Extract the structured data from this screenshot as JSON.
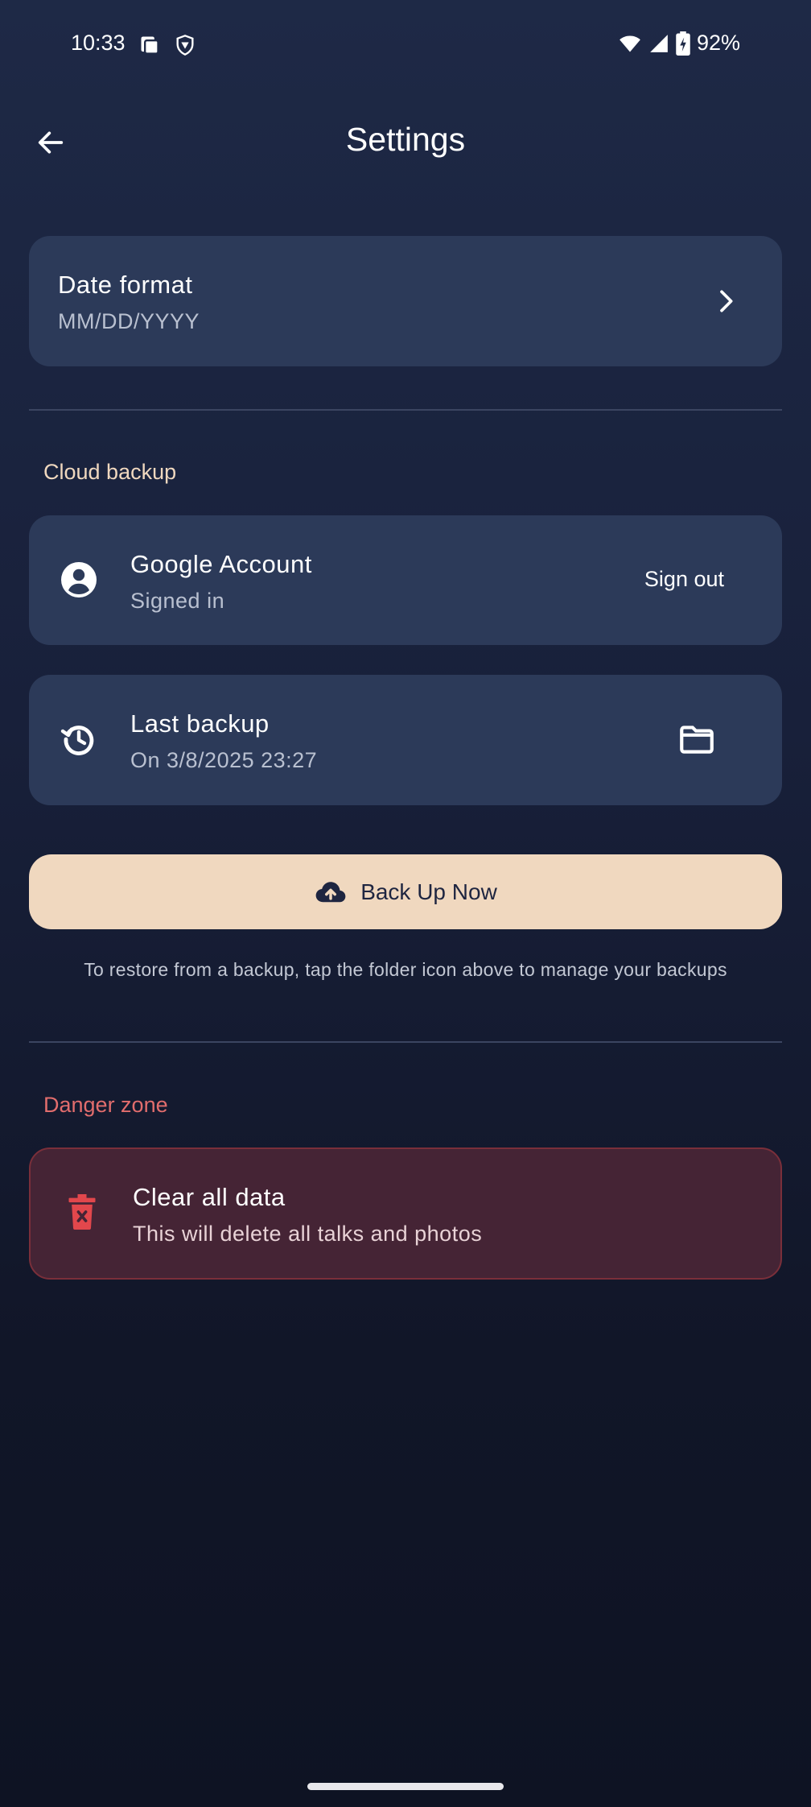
{
  "status_bar": {
    "time": "10:33",
    "battery": "92%"
  },
  "header": {
    "title": "Settings"
  },
  "date_format": {
    "title": "Date format",
    "value": "MM/DD/YYYY"
  },
  "cloud_backup": {
    "section_label": "Cloud backup",
    "account": {
      "title": "Google Account",
      "status": "Signed in",
      "action": "Sign out"
    },
    "last_backup": {
      "title": "Last backup",
      "value": "On 3/8/2025 23:27"
    },
    "backup_button": "Back Up Now",
    "restore_hint": "To restore from a backup, tap the folder icon above to manage your backups"
  },
  "danger_zone": {
    "section_label": "Danger zone",
    "clear": {
      "title": "Clear all data",
      "description": "This will delete all talks and photos"
    }
  },
  "colors": {
    "accent": "#f0d8bf",
    "danger": "#e26d6d",
    "card": "#2c3a59"
  },
  "icons": [
    "arrow-left-icon",
    "chevron-right-icon",
    "account-circle-icon",
    "history-icon",
    "folder-icon",
    "cloud-upload-icon",
    "trash-icon"
  ]
}
